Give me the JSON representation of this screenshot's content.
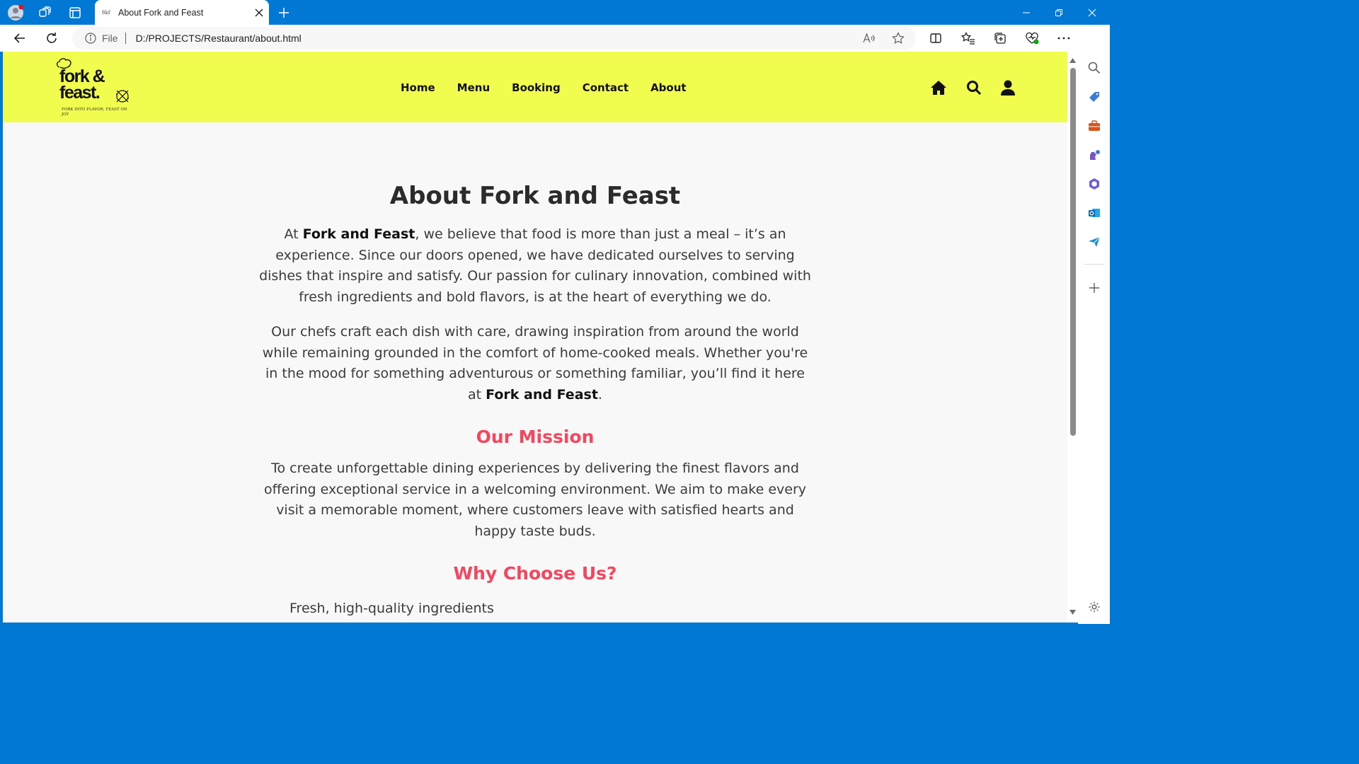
{
  "browser": {
    "tab": {
      "title": "About Fork and Feast",
      "favicon_text": "f&f"
    },
    "address": {
      "scheme_label": "File",
      "url": "D:/PROJECTS/Restaurant/about.html"
    }
  },
  "site": {
    "logo": {
      "line1": "fork &",
      "line2": "feast.",
      "tagline": "FORK INTO FLAVOR, FEAST ON JOY"
    },
    "nav": [
      "Home",
      "Menu",
      "Booking",
      "Contact",
      "About"
    ]
  },
  "page": {
    "title": "About Fork and Feast",
    "intro": {
      "prefix": "At ",
      "brand": "Fork and Feast",
      "rest": ", we believe that food is more than just a meal – it’s an experience. Since our doors opened, we have dedicated ourselves to serving dishes that inspire and satisfy. Our passion for culinary innovation, combined with fresh ingredients and bold flavors, is at the heart of everything we do."
    },
    "chefs": {
      "text": "Our chefs craft each dish with care, drawing inspiration from around the world while remaining grounded in the comfort of home-cooked meals. Whether you're in the mood for something adventurous or something familiar, you’ll find it here at ",
      "brand": "Fork and Feast",
      "suffix": "."
    },
    "mission": {
      "heading": "Our Mission",
      "text": "To create unforgettable dining experiences by delivering the finest flavors and offering exceptional service in a welcoming environment. We aim to make every visit a memorable moment, where customers leave with satisfied hearts and happy taste buds."
    },
    "why": {
      "heading": "Why Choose Us?",
      "items": [
        "Fresh, high-quality ingredients"
      ]
    }
  },
  "colors": {
    "header_bg": "#f0fc4e",
    "accent_heading": "#f2475e",
    "browser_frame": "#0078d4",
    "page_bg": "#f8f8f8"
  }
}
